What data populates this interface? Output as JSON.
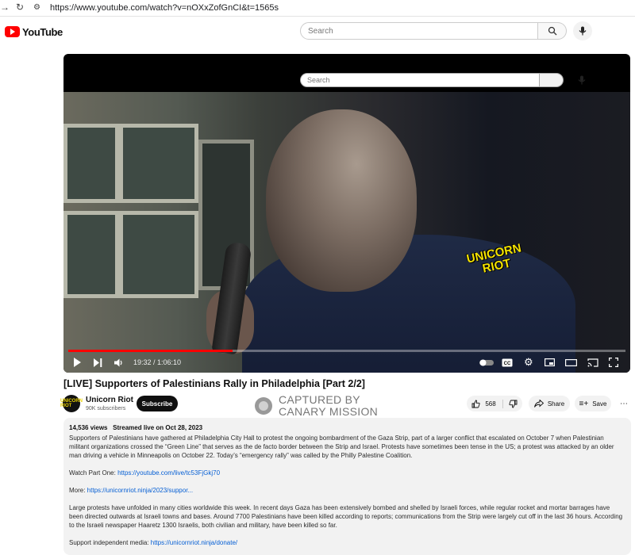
{
  "browser": {
    "url": "https://www.youtube.com/watch?v=nOXxZofGnCI&t=1565s"
  },
  "masthead": {
    "logo_text": "YouTube",
    "search_placeholder": "Search"
  },
  "player": {
    "overlay_search_placeholder": "Search",
    "watermark": "UNICORN RIOT",
    "time_display": "19:32 / 1:06:10",
    "progress_fraction": 0.2952
  },
  "video": {
    "title": "[LIVE] Supporters of Palestinians Rally in Philadelphia [Part 2/2]",
    "channel_name": "Unicorn Riot",
    "channel_subs": "90K subscribers",
    "avatar_text": "UNICORN RIOT",
    "subscribe_label": "Subscribe",
    "like_count": "568",
    "share_label": "Share",
    "save_label": "Save",
    "more_label": "···"
  },
  "overlay_stamp": {
    "line1": "CAPTURED BY",
    "line2": "CANARY MISSION"
  },
  "description": {
    "views": "14,536 views",
    "streamed": "Streamed live on Oct 28, 2023",
    "p1": "Supporters of Palestinians have gathered at Philadelphia City Hall to protest the ongoing bombardment of the Gaza Strip, part of a larger conflict that escalated on October 7 when Palestinian militant organizations crossed the “Green Line” that serves as the de facto border between the Strip and Israel. Protests have sometimes been tense in the US; a protest was attacked by an older man driving a vehicle in Minneapolis on October 22. Today’s “emergency rally” was called by the Philly Palestine Coalition.",
    "part_one_label": "Watch Part One: ",
    "part_one_link": "https://youtube.com/live/tc53FjGkj70",
    "more_label": "More: ",
    "more_link": "https://unicornriot.ninja/2023/suppor...",
    "p2": "Large protests have unfolded in many cities worldwide this week. In recent days Gaza has been extensively bombed and shelled by Israeli forces, while regular rocket and mortar barrages have been directed outwards at Israeli towns and bases. Around 7700 Palestinians have been killed according to reports; communications from the Strip were largely cut off in the last 36 hours. According to the Israeli newspaper Haaretz 1300 Israelis, both civilian and military, have been killed so far.",
    "support_label": "Support independent media: ",
    "support_link": "https://unicornriot.ninja/donate/"
  }
}
